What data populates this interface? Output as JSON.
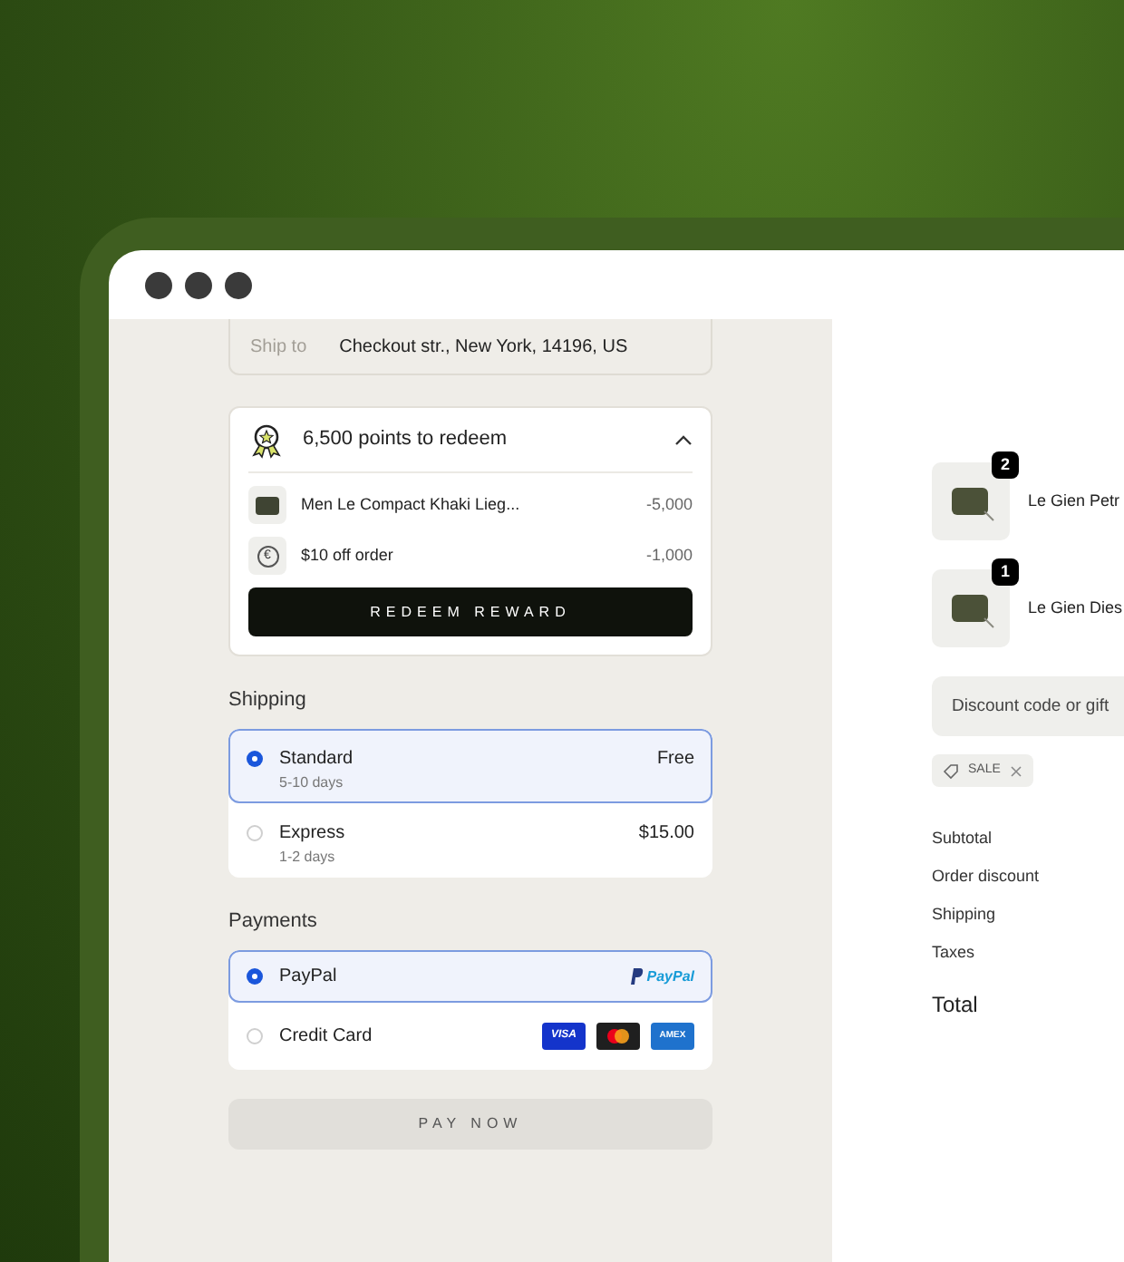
{
  "ship_to": {
    "label": "Ship to",
    "value": "Checkout str., New York, 14196, US"
  },
  "rewards": {
    "title": "6,500 points to redeem",
    "expanded": true,
    "items": [
      {
        "kind": "product",
        "name": "Men Le Compact Khaki Lieg...",
        "points": "-5,000"
      },
      {
        "kind": "coupon",
        "icon": "€",
        "name": "$10 off order",
        "points": "-1,000"
      }
    ],
    "button": "REDEEM REWARD"
  },
  "shipping": {
    "title": "Shipping",
    "options": [
      {
        "name": "Standard",
        "detail": "5-10 days",
        "price": "Free",
        "selected": true
      },
      {
        "name": "Express",
        "detail": "1-2 days",
        "price": "$15.00",
        "selected": false
      }
    ]
  },
  "payments": {
    "title": "Payments",
    "options": [
      {
        "name": "PayPal",
        "kind": "paypal",
        "logo": "PayPal",
        "selected": true
      },
      {
        "name": "Credit Card",
        "kind": "cards",
        "cards": [
          "VISA",
          "AMEX"
        ],
        "selected": false
      }
    ]
  },
  "pay_button": "PAY NOW",
  "cart": {
    "items": [
      {
        "name": "Le Gien Petr",
        "quantity": "2"
      },
      {
        "name": "Le Gien Dies",
        "quantity": "1"
      }
    ],
    "discount": {
      "placeholder": "Discount code or gift"
    },
    "tags": [
      {
        "label": "SALE",
        "removable": true
      }
    ],
    "summary": [
      "Subtotal",
      "Order discount",
      "Shipping",
      "Taxes"
    ],
    "total": "Total"
  }
}
